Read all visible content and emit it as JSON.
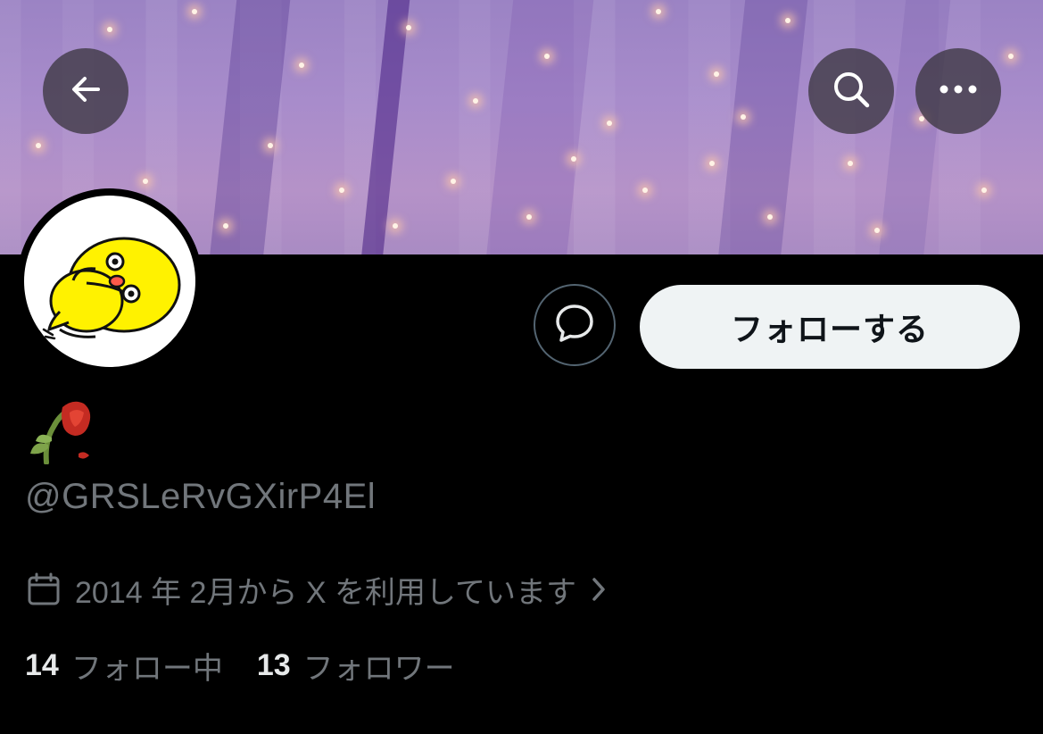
{
  "profile": {
    "handle": "@GRSLeRvGXirP4El",
    "display_name_emoji": "wilted-rose-emoji",
    "joined": "2014 年 2月から X を利用しています",
    "following_count": "14",
    "following_label": "フォロー中",
    "followers_count": "13",
    "followers_label": "フォロワー"
  },
  "actions": {
    "follow_label": "フォローする"
  },
  "icons": {
    "back": "arrow-left-icon",
    "search": "search-icon",
    "more": "more-horizontal-icon",
    "message": "message-bubble-icon",
    "calendar": "calendar-icon",
    "chevron": "chevron-right-icon"
  },
  "colors": {
    "background": "#000000",
    "follow_button_bg": "#eff3f4",
    "secondary_text": "#71767b",
    "primary_text": "#e7e9ea"
  }
}
